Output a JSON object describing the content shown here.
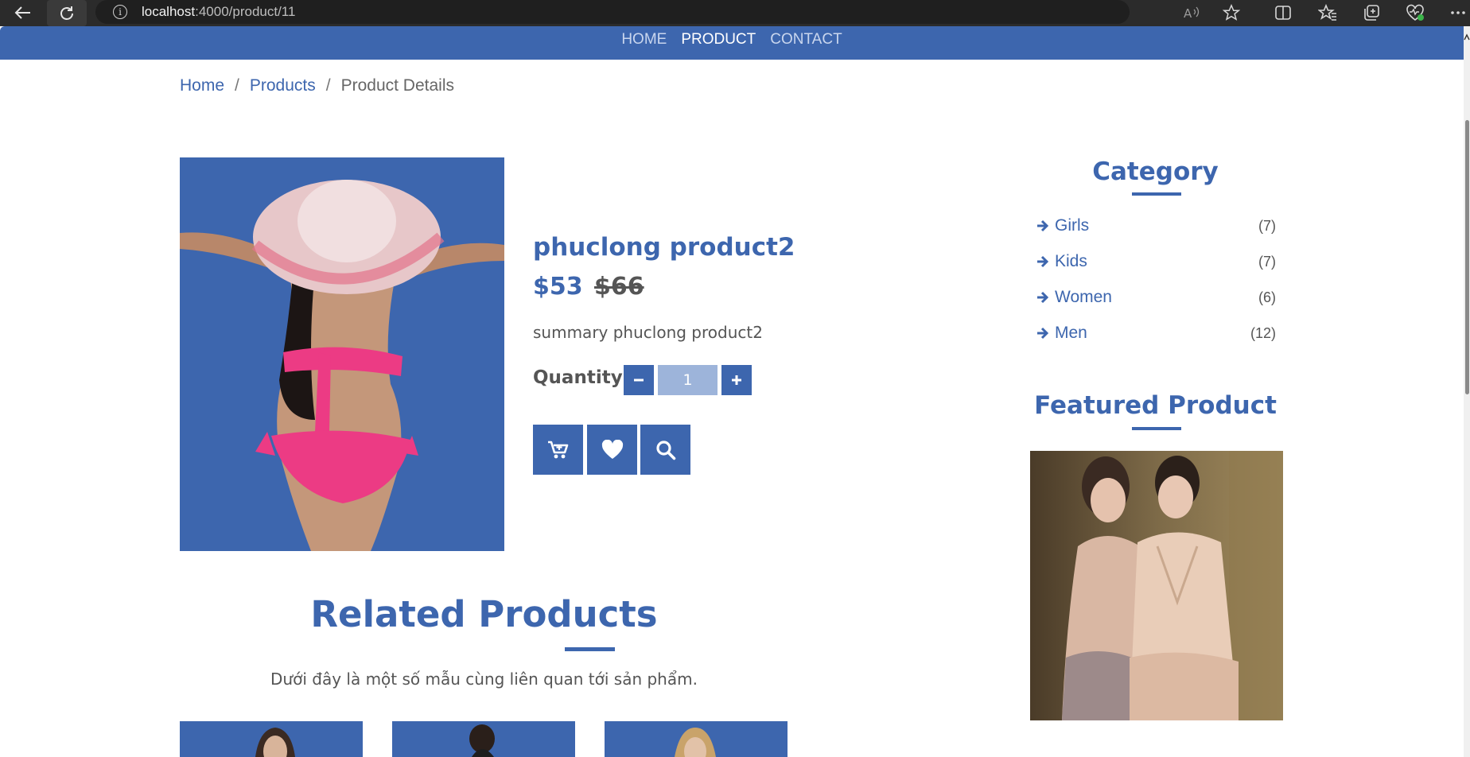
{
  "browser": {
    "url_host": "localhost",
    "url_rest": ":4000/product/11"
  },
  "nav": {
    "items": [
      {
        "label": "HOME",
        "active": false
      },
      {
        "label": "PRODUCT",
        "active": true
      },
      {
        "label": "CONTACT",
        "active": false
      }
    ]
  },
  "breadcrumb": {
    "home": "Home",
    "products": "Products",
    "current": "Product Details",
    "separator": "/"
  },
  "product": {
    "name": "phuclong product2",
    "price": "$53",
    "old_price": "$66",
    "summary": "summary phuclong product2",
    "quantity_label": "Quantity:",
    "quantity_value": "1",
    "minus_label": "−",
    "plus_label": "+"
  },
  "sidebar": {
    "category_title": "Category",
    "categories": [
      {
        "name": "Girls",
        "count": "(7)"
      },
      {
        "name": "Kids",
        "count": "(7)"
      },
      {
        "name": "Women",
        "count": "(6)"
      },
      {
        "name": "Men",
        "count": "(12)"
      }
    ],
    "featured_title": "Featured Product"
  },
  "related": {
    "title": "Related Products",
    "subtitle": "Dưới đây là một số mẫu cùng liên quan tới sản phẩm."
  },
  "colors": {
    "brand": "#3d66ae",
    "quantity_input_bg": "#9db4da",
    "browser_chrome": "#2b2b2b"
  }
}
